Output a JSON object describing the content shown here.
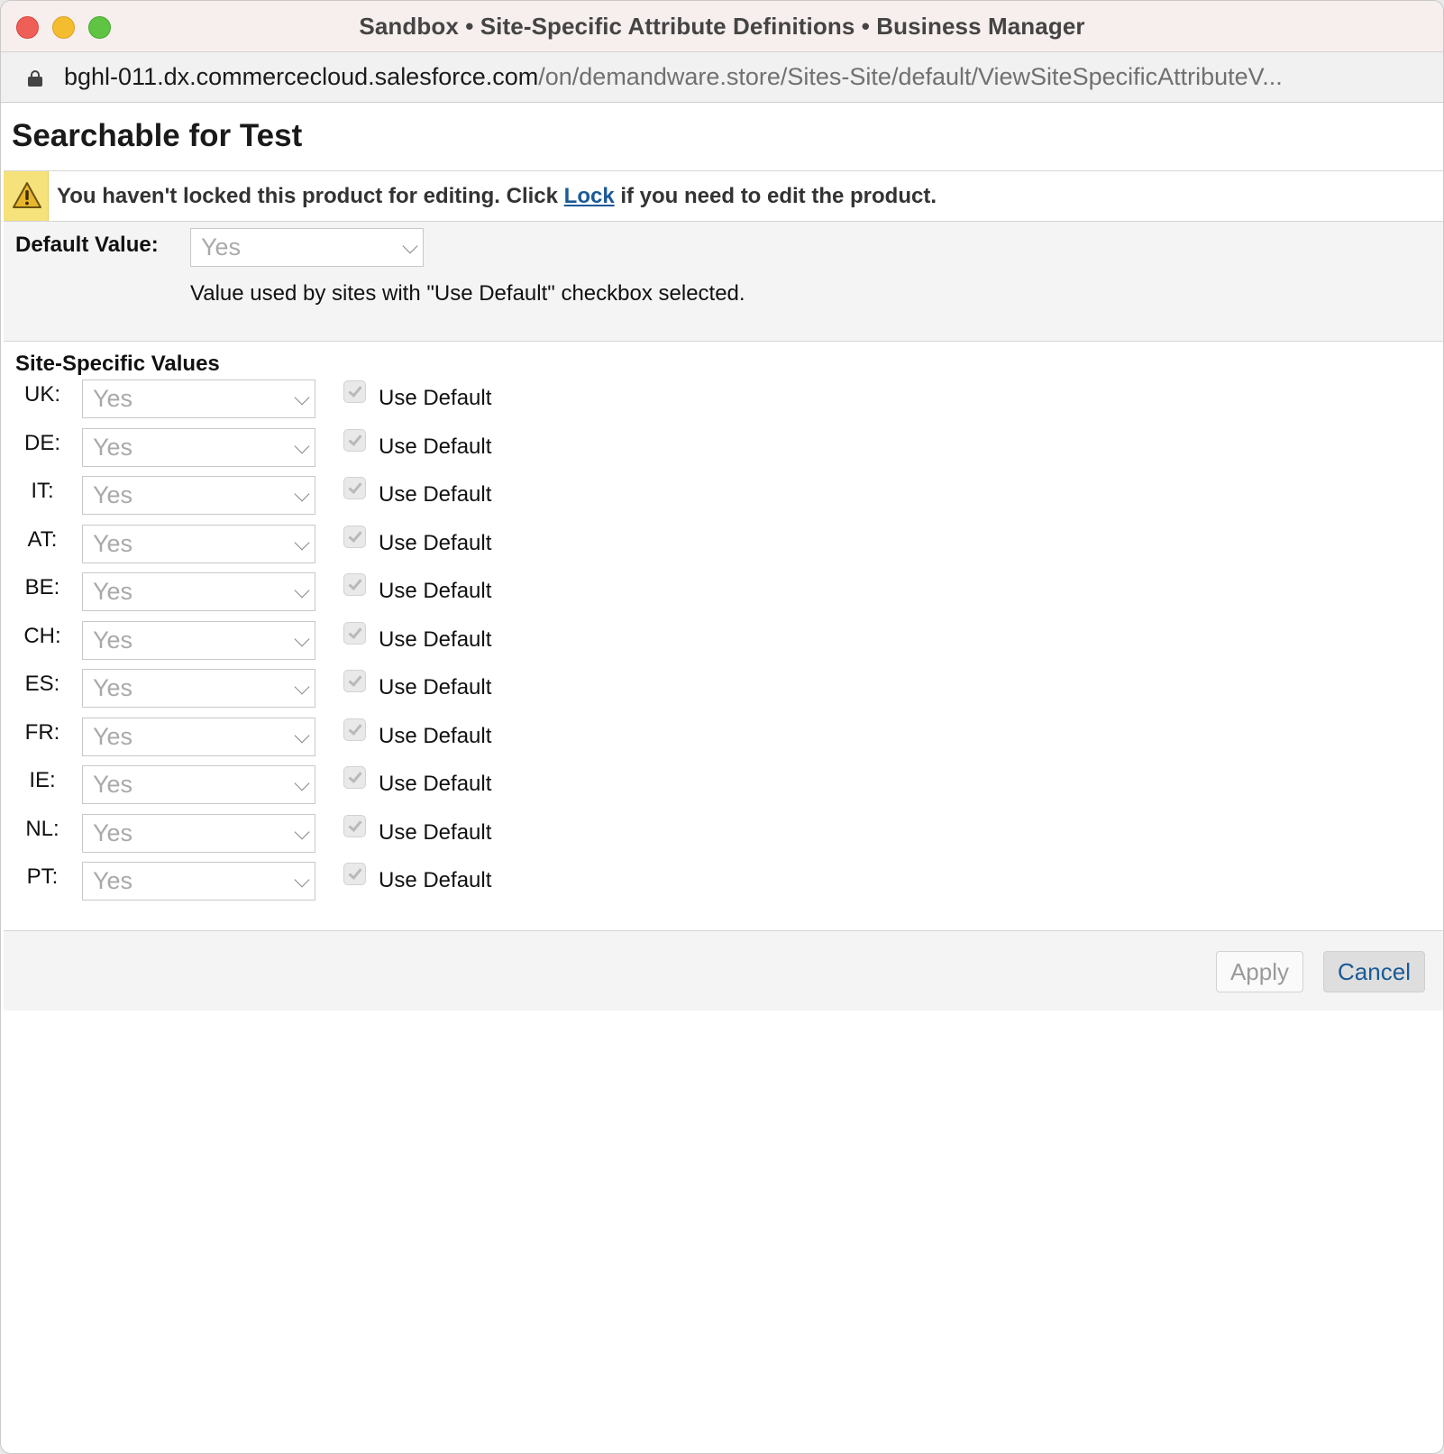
{
  "window": {
    "title": "Sandbox • Site-Specific Attribute Definitions • Business Manager"
  },
  "address_bar": {
    "url_host": "bghl-011.dx.commercecloud.salesforce.com",
    "url_path": "/on/demandware.store/Sites-Site/default/ViewSiteSpecificAttributeV..."
  },
  "page": {
    "title": "Searchable for Test"
  },
  "notice": {
    "text_before": "You haven't locked this product for editing. Click ",
    "link_label": "Lock",
    "text_after": " if you need to edit the product."
  },
  "default_value": {
    "label": "Default Value:",
    "selected": "Yes",
    "hint": "Value used by sites with \"Use Default\" checkbox selected."
  },
  "site_values": {
    "heading": "Site-Specific Values",
    "checkbox_label": "Use Default",
    "sites": [
      {
        "label": "UK:",
        "value": "Yes",
        "use_default": true
      },
      {
        "label": "DE:",
        "value": "Yes",
        "use_default": true
      },
      {
        "label": "IT:",
        "value": "Yes",
        "use_default": true
      },
      {
        "label": "AT:",
        "value": "Yes",
        "use_default": true
      },
      {
        "label": "BE:",
        "value": "Yes",
        "use_default": true
      },
      {
        "label": "CH:",
        "value": "Yes",
        "use_default": true
      },
      {
        "label": "ES:",
        "value": "Yes",
        "use_default": true
      },
      {
        "label": "FR:",
        "value": "Yes",
        "use_default": true
      },
      {
        "label": "IE:",
        "value": "Yes",
        "use_default": true
      },
      {
        "label": "NL:",
        "value": "Yes",
        "use_default": true
      },
      {
        "label": "PT:",
        "value": "Yes",
        "use_default": true
      }
    ]
  },
  "footer": {
    "apply_label": "Apply",
    "cancel_label": "Cancel"
  },
  "colors": {
    "link": "#1a5a96",
    "warning": "#f6e27a"
  }
}
